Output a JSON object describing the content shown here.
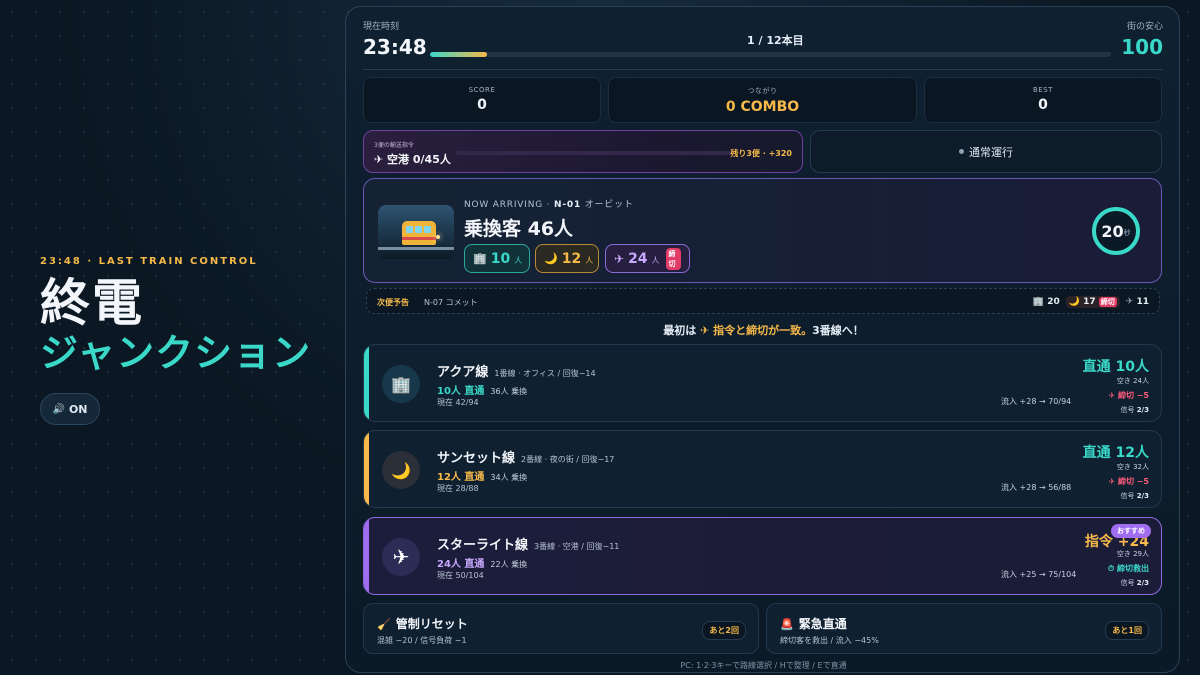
{
  "brand": {
    "kicker": "23:48 · LAST TRAIN CONTROL",
    "title_line1": "終電",
    "title_line2": "ジャンクション",
    "sound_icon": "speaker-icon",
    "sound_label": "ON"
  },
  "header": {
    "time_label": "現在時刻",
    "time": "23:48",
    "progress_label": "1 / 12本目",
    "progress_fraction": 0.083,
    "safety_label": "街の安心",
    "safety_value": "100"
  },
  "stats": {
    "score_label": "SCORE",
    "score": "0",
    "combo_label": "つながり",
    "combo": "0 COMBO",
    "best_label": "BEST",
    "best": "0"
  },
  "order": {
    "label": "3便の輸送指令",
    "value": "✈ 空港 0/45人",
    "remaining": "残り3便 · +320",
    "progress": 0
  },
  "status": {
    "normal": "通常運行"
  },
  "arrival": {
    "kicker_prefix": "NOW ARRIVING ·",
    "train_id": "N-01",
    "train_name": "オービット",
    "title": "乗換客 46人",
    "office_icon": "🏢",
    "office_count": "10",
    "office_unit": "人",
    "night_icon": "🌙",
    "night_count": "12",
    "night_unit": "人",
    "air_icon": "✈",
    "air_count": "24",
    "air_unit": "人",
    "air_tag": "締切",
    "timer_value": "20",
    "timer_unit": "秒"
  },
  "next": {
    "label": "次便予告",
    "train": "N-07 コメット",
    "office": "20",
    "night": "17",
    "night_tag": "締切",
    "air": "11"
  },
  "hint": {
    "prefix": "最初は",
    "accent": "✈ 指令と締切が一致。",
    "suffix": "3番線へ！"
  },
  "lines": [
    {
      "name": "アクア線",
      "sub": "1番線 · オフィス / 回復−14",
      "direct": "10人 直通",
      "transfer": "36人 乗換",
      "now": "現在 42/94",
      "flow": "流入 +28 → 70/94",
      "big": "直通 10人",
      "vacancy": "空き 24人",
      "deadline": "✈ 締切 −5",
      "signal_label": "信号",
      "signal": "2/3",
      "color": "#3ad8c8"
    },
    {
      "name": "サンセット線",
      "sub": "2番線 · 夜の街 / 回復−17",
      "direct": "12人 直通",
      "transfer": "34人 乗換",
      "now": "現在 28/88",
      "flow": "流入 +28 → 56/88",
      "big": "直通 12人",
      "vacancy": "空き 32人",
      "deadline": "✈ 締切 −5",
      "signal_label": "信号",
      "signal": "2/3",
      "color": "#f6b94a"
    },
    {
      "name": "スターライト線",
      "sub": "3番線 · 空港 / 回復−11",
      "direct": "24人 直通",
      "transfer": "22人 乗換",
      "now": "現在 50/104",
      "flow": "流入 +25 → 75/104",
      "big": "指令 +24",
      "vacancy": "空き 29人",
      "deadline": "⏱ 締切救出",
      "signal_label": "信号",
      "signal": "2/3",
      "badge": "おすすめ",
      "color": "#a06cf0"
    }
  ],
  "skills": [
    {
      "icon": "🧹",
      "name": "管制リセット",
      "desc": "混雑 −20 / 信号負荷 −1",
      "count": "あと2回"
    },
    {
      "icon": "🚨",
      "name": "緊急直通",
      "desc": "締切客を救出 / 流入 −45%",
      "count": "あと1回"
    }
  ],
  "footer": "PC: 1·2·3キーで路線選択 / Hで整理 / Eで直通"
}
